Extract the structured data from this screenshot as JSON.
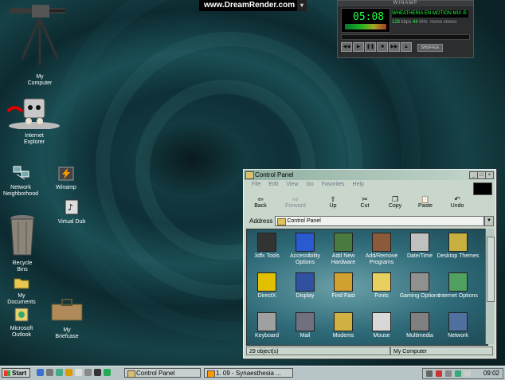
{
  "banner": {
    "text": "www.DreamRender.com",
    "arrow": "▾"
  },
  "winamp": {
    "title_bar": "WINAMP",
    "time": "05:08",
    "scroll_title": "WHEATHERIA EN MOTION MIX /5",
    "kbps": "128",
    "kbps_unit": "kbps",
    "khz": "44",
    "khz_unit": "kHz",
    "mono": "mono",
    "stereo": "stereo",
    "shuffle": "SHUFFLE",
    "buttons": [
      "◀◀",
      "▶",
      "❚❚",
      "■",
      "▶▶",
      "▲"
    ]
  },
  "desktop": {
    "icons": [
      {
        "label": "My\nComputer",
        "icon": "machine-gun-icon"
      },
      {
        "label": "Internet\nExplorer",
        "icon": "phone-face-icon"
      },
      {
        "label": "Network\nNeighborhood",
        "icon": "network-icon"
      },
      {
        "label": "Winamp",
        "icon": "lightning-icon"
      },
      {
        "label": "Virtual Dub",
        "icon": "vdub-icon"
      },
      {
        "label": "Recycle\nBins",
        "icon": "trash-can-icon"
      },
      {
        "label": "My\nDocuments",
        "icon": "folder-icon"
      },
      {
        "label": "Microsoft\nOutlook",
        "icon": "outlook-icon"
      },
      {
        "label": "My\nBriefcase",
        "icon": "briefcase-icon"
      }
    ]
  },
  "window": {
    "title": "Control Panel",
    "menu": [
      "File",
      "Edit",
      "View",
      "Go",
      "Favorites",
      "Help"
    ],
    "toolbar": [
      {
        "label": "Back",
        "glyph": "⇦",
        "enabled": true
      },
      {
        "label": "Forward",
        "glyph": "⇨",
        "enabled": false
      },
      {
        "label": "Up",
        "glyph": "⇧",
        "enabled": true
      },
      {
        "label": "Cut",
        "glyph": "✂",
        "enabled": true
      },
      {
        "label": "Copy",
        "glyph": "❐",
        "enabled": true
      },
      {
        "label": "Paste",
        "glyph": "📋",
        "enabled": true
      },
      {
        "label": "Undo",
        "glyph": "↶",
        "enabled": true
      }
    ],
    "address_label": "Address",
    "address_value": "Control Panel",
    "items": [
      {
        "label": "3dfx Tools",
        "color": "#333333"
      },
      {
        "label": "Accessibility Options",
        "color": "#2a5ad0"
      },
      {
        "label": "Add New Hardware",
        "color": "#4a7a40"
      },
      {
        "label": "Add/Remove Programs",
        "color": "#8a5a3a"
      },
      {
        "label": "Date/Time",
        "color": "#c0c0c0"
      },
      {
        "label": "Desktop Themes",
        "color": "#c8b040"
      },
      {
        "label": "DirectX",
        "color": "#e0c000"
      },
      {
        "label": "Display",
        "color": "#3050a0"
      },
      {
        "label": "Find Fast",
        "color": "#d0a030"
      },
      {
        "label": "Fonts",
        "color": "#e8d060"
      },
      {
        "label": "Gaming Options",
        "color": "#909090"
      },
      {
        "label": "Internet Options",
        "color": "#50a060"
      },
      {
        "label": "Keyboard",
        "color": "#a0a0a0"
      },
      {
        "label": "Mail",
        "color": "#707080"
      },
      {
        "label": "Modems",
        "color": "#d0b040"
      },
      {
        "label": "Mouse",
        "color": "#d8d8d8"
      },
      {
        "label": "Multimedia",
        "color": "#808080"
      },
      {
        "label": "Network",
        "color": "#5070a0"
      }
    ],
    "status_left": "29 object(s)",
    "status_right": "My Computer"
  },
  "taskbar": {
    "start": "Start",
    "tasks": [
      "Control Panel",
      "1. 09 - Synaesthesia ..."
    ],
    "clock": "09:02"
  }
}
